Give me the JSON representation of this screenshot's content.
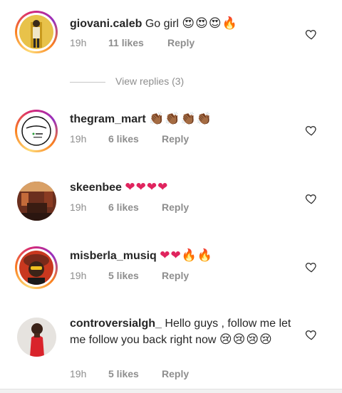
{
  "comments": [
    {
      "username": "giovani.caleb",
      "text": "Go girl",
      "emoji": "😍😍😍🔥",
      "time": "19h",
      "likes": "11 likes",
      "reply": "Reply"
    },
    {
      "username": "thegram_mart",
      "text": "",
      "emoji": "👏🏾👏🏾👏🏾👏🏾",
      "time": "19h",
      "likes": "6 likes",
      "reply": "Reply"
    },
    {
      "username": "skeenbee",
      "text": "",
      "emoji": "❤❤❤❤",
      "time": "19h",
      "likes": "6 likes",
      "reply": "Reply"
    },
    {
      "username": "misberla_musiq",
      "text": "",
      "emoji": "❤❤🔥🔥",
      "time": "19h",
      "likes": "5 likes",
      "reply": "Reply"
    },
    {
      "username": "controversialgh_",
      "text": "Hello guys , follow me let me follow you back right now",
      "emoji": "😢😢😢😢",
      "time": "19h",
      "likes": "5 likes",
      "reply": "Reply"
    }
  ],
  "view_replies": "View replies (3)",
  "icons": {
    "like": "heart-outline-icon"
  },
  "colors": {
    "heart": "#e0245e",
    "muted": "#8e8e8e",
    "text": "#262626"
  }
}
